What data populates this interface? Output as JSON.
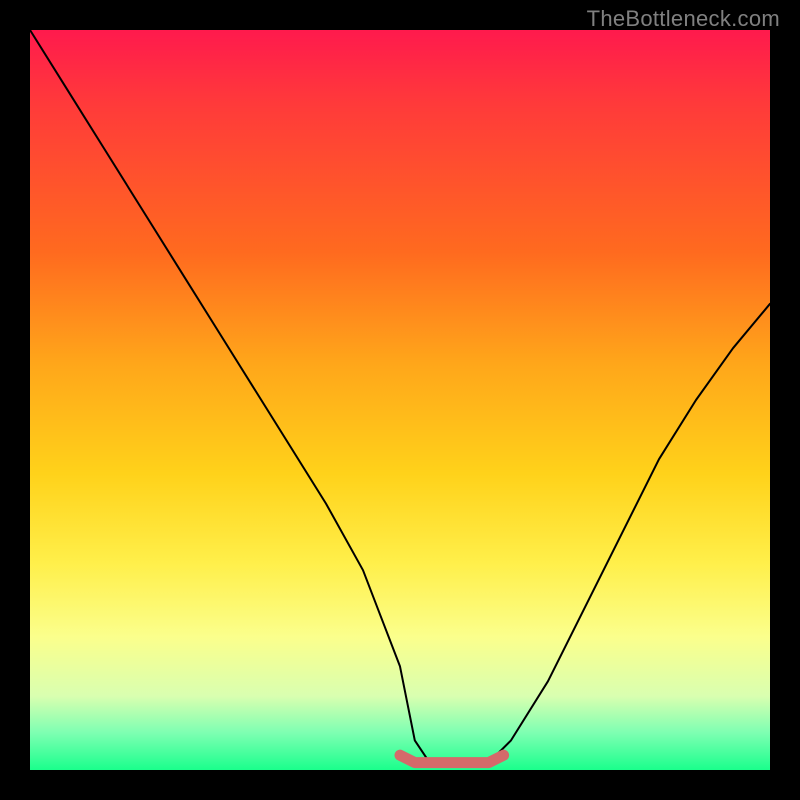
{
  "watermark": "TheBottleneck.com",
  "chart_data": {
    "type": "line",
    "title": "",
    "xlabel": "",
    "ylabel": "",
    "xlim": [
      0,
      100
    ],
    "ylim": [
      0,
      100
    ],
    "series": [
      {
        "name": "bottleneck-curve",
        "x": [
          0,
          5,
          10,
          15,
          20,
          25,
          30,
          35,
          40,
          45,
          50,
          52,
          54,
          56,
          58,
          60,
          62,
          65,
          70,
          75,
          80,
          85,
          90,
          95,
          100
        ],
        "values": [
          100,
          92,
          84,
          76,
          68,
          60,
          52,
          44,
          36,
          27,
          14,
          4,
          1,
          1,
          1,
          1,
          1,
          4,
          12,
          22,
          32,
          42,
          50,
          57,
          63
        ]
      },
      {
        "name": "optimal-band",
        "x": [
          50,
          52,
          54,
          56,
          58,
          60,
          62,
          64
        ],
        "values": [
          2,
          1,
          1,
          1,
          1,
          1,
          1,
          2
        ]
      }
    ],
    "annotations": []
  },
  "colors": {
    "curve": "#000000",
    "optimal_band": "#d46a6a",
    "background_top": "#ff1a4d",
    "background_bottom": "#1aff8c",
    "frame": "#000000"
  }
}
